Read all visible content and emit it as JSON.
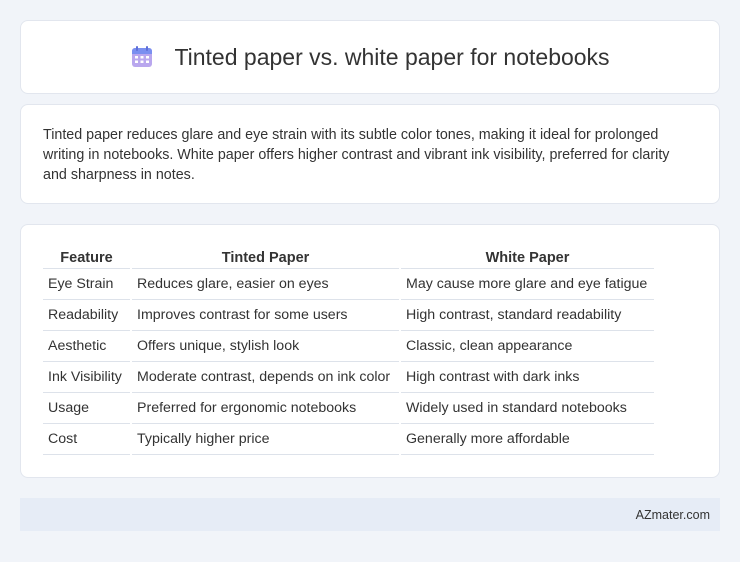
{
  "header": {
    "title": "Tinted paper vs. white paper for notebooks",
    "icon": "calendar-icon"
  },
  "summary": {
    "text": "Tinted paper reduces glare and eye strain with its subtle color tones, making it ideal for prolonged writing in notebooks. White paper offers higher contrast and vibrant ink visibility, preferred for clarity and sharpness in notes."
  },
  "table": {
    "headers": [
      "Feature",
      "Tinted Paper",
      "White Paper"
    ],
    "rows": [
      [
        "Eye Strain",
        "Reduces glare, easier on eyes",
        "May cause more glare and eye fatigue"
      ],
      [
        "Readability",
        "Improves contrast for some users",
        "High contrast, standard readability"
      ],
      [
        "Aesthetic",
        "Offers unique, stylish look",
        "Classic, clean appearance"
      ],
      [
        "Ink Visibility",
        "Moderate contrast, depends on ink color",
        "High contrast with dark inks"
      ],
      [
        "Usage",
        "Preferred for ergonomic notebooks",
        "Widely used in standard notebooks"
      ],
      [
        "Cost",
        "Typically higher price",
        "Generally more affordable"
      ]
    ]
  },
  "footer": {
    "text": "AZmater.com"
  }
}
